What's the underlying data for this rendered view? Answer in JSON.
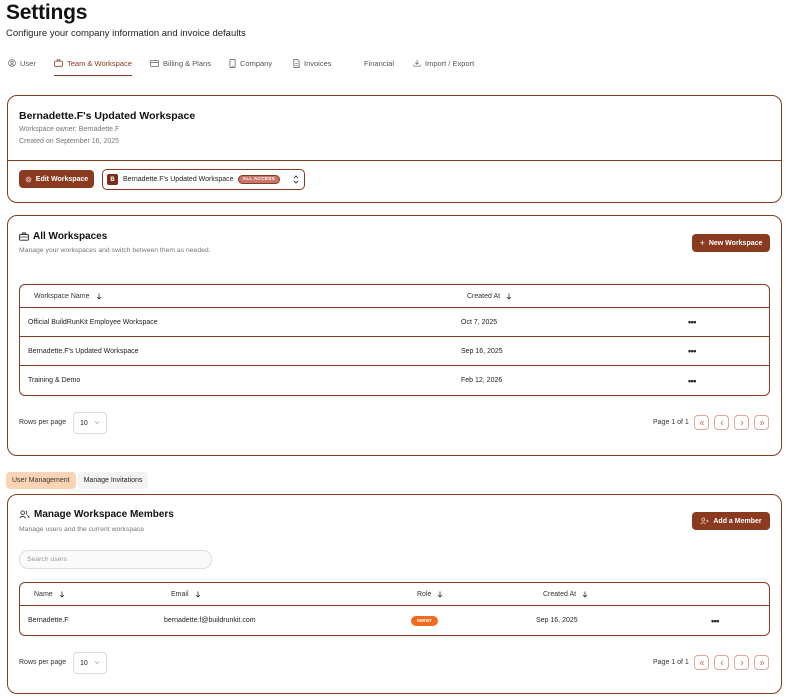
{
  "header": {
    "title": "Settings",
    "subtitle": "Configure your company information and invoice defaults"
  },
  "tabs": [
    {
      "label": "User",
      "icon": "user-circle-icon",
      "active": false
    },
    {
      "label": "Team & Workspace",
      "icon": "briefcase-icon",
      "active": true
    },
    {
      "label": "Billing & Plans",
      "icon": "credit-card-icon",
      "active": false
    },
    {
      "label": "Company",
      "icon": "phone-icon",
      "active": false
    },
    {
      "label": "Invoices",
      "icon": "document-icon",
      "active": false
    },
    {
      "label": "Financial",
      "icon": "",
      "active": false
    },
    {
      "label": "Import / Export",
      "icon": "download-icon",
      "active": false
    }
  ],
  "workspace_card": {
    "title": "Bernadette.F's Updated Workspace",
    "owner": "Workspace owner: Bernadette.F",
    "created": "Created on September 16, 2025",
    "edit_button": "Edit Workspace",
    "selector": {
      "initial": "B",
      "name": "Bernadette.F's Updated Workspace",
      "badge": "ALL ACCESS"
    }
  },
  "all_workspaces": {
    "title": "All Workspaces",
    "subtitle": "Manage your workspaces and switch between them as needed.",
    "new_button": "New Workspace",
    "columns": [
      "Workspace Name",
      "Created At"
    ],
    "rows": [
      {
        "name": "Official BuildRunKit Employee Workspace",
        "created": "Oct 7, 2025",
        "actions": "•••"
      },
      {
        "name": "Bernadette.F's Updated Workspace",
        "created": "Sep 16, 2025",
        "actions": "•••"
      },
      {
        "name": "Training & Demo",
        "created": "Feb 12, 2026",
        "actions": "•••"
      }
    ],
    "rows_per_page_label": "Rows per page",
    "rows_per_page": "10",
    "page_info": "Page 1 of 1"
  },
  "subtabs": {
    "user_management": "User Management",
    "manage_invitations": "Manage Invitations"
  },
  "members": {
    "title": "Manage Workspace Members",
    "subtitle": "Manage users and the current workspace",
    "add_button": "Add a Member",
    "search_placeholder": "Search users",
    "columns": [
      "Name",
      "Email",
      "Role",
      "Created At"
    ],
    "rows": [
      {
        "name": "Bernadette.F",
        "email": "bernadette.f@buildrunkit.com",
        "role": "owner",
        "created": "Sep 16, 2025",
        "actions": "•••"
      }
    ],
    "rows_per_page_label": "Rows per page",
    "rows_per_page": "10",
    "page_info": "Page 1 of 1"
  },
  "colors": {
    "accent": "#8a3a1e",
    "owner_badge": "#f26b1d",
    "subtab_active": "#fbd5b3"
  }
}
